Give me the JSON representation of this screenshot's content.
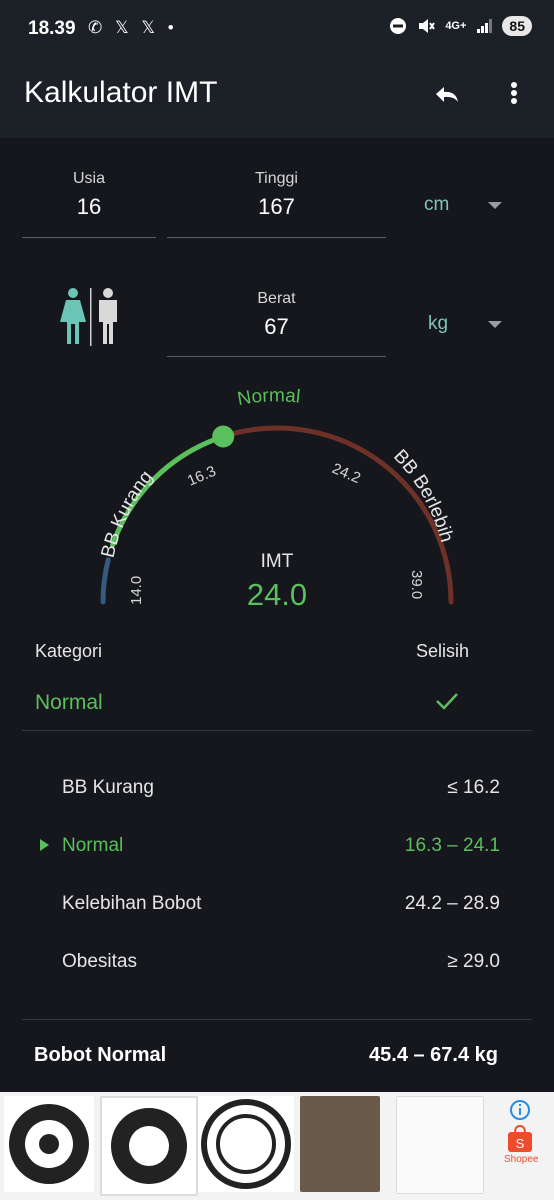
{
  "status": {
    "time": "18.39",
    "left_icons": "✆ 𝕏 𝕏 •",
    "signal": "4G+",
    "battery": "85"
  },
  "appbar": {
    "title": "Kalkulator IMT",
    "undo_icon": "undo-icon",
    "more_icon": "more-vert-icon"
  },
  "inputs": {
    "age_label": "Usia",
    "age_value": "16",
    "height_label": "Tinggi",
    "height_value": "167",
    "height_unit": "cm",
    "weight_label": "Berat",
    "weight_value": "67",
    "weight_unit": "kg"
  },
  "gauge": {
    "low_label": "BB Kurang",
    "normal_label": "Normal",
    "high_label": "BB Berlebih",
    "tick_min": "14.0",
    "tick_low": "16.3",
    "tick_high": "24.2",
    "tick_max": "39.0",
    "result_label": "IMT",
    "result_value": "24.0",
    "bmi": 24.0,
    "min": 14.0,
    "low_boundary": 16.3,
    "high_boundary": 24.2,
    "max": 39.0,
    "colors": {
      "low": "#355a80",
      "normal": "#5bbf5d",
      "high": "#6e3128"
    }
  },
  "category": {
    "header": "Kategori",
    "diff_header": "Selisih",
    "value": "Normal",
    "diff_icon": "check-icon"
  },
  "table": [
    {
      "name": "BB Kurang",
      "range": "≤ 16.2"
    },
    {
      "name": "Normal",
      "range": "16.3 – 24.1"
    },
    {
      "name": "Kelebihan Bobot",
      "range": "24.2 – 28.9"
    },
    {
      "name": "Obesitas",
      "range": "≥ 29.0"
    }
  ],
  "normal_weight": {
    "label": "Bobot Normal",
    "value": "45.4 – 67.4 kg"
  },
  "ad": {
    "shopee_label": "Shopee",
    "info_icon": "info-icon"
  }
}
